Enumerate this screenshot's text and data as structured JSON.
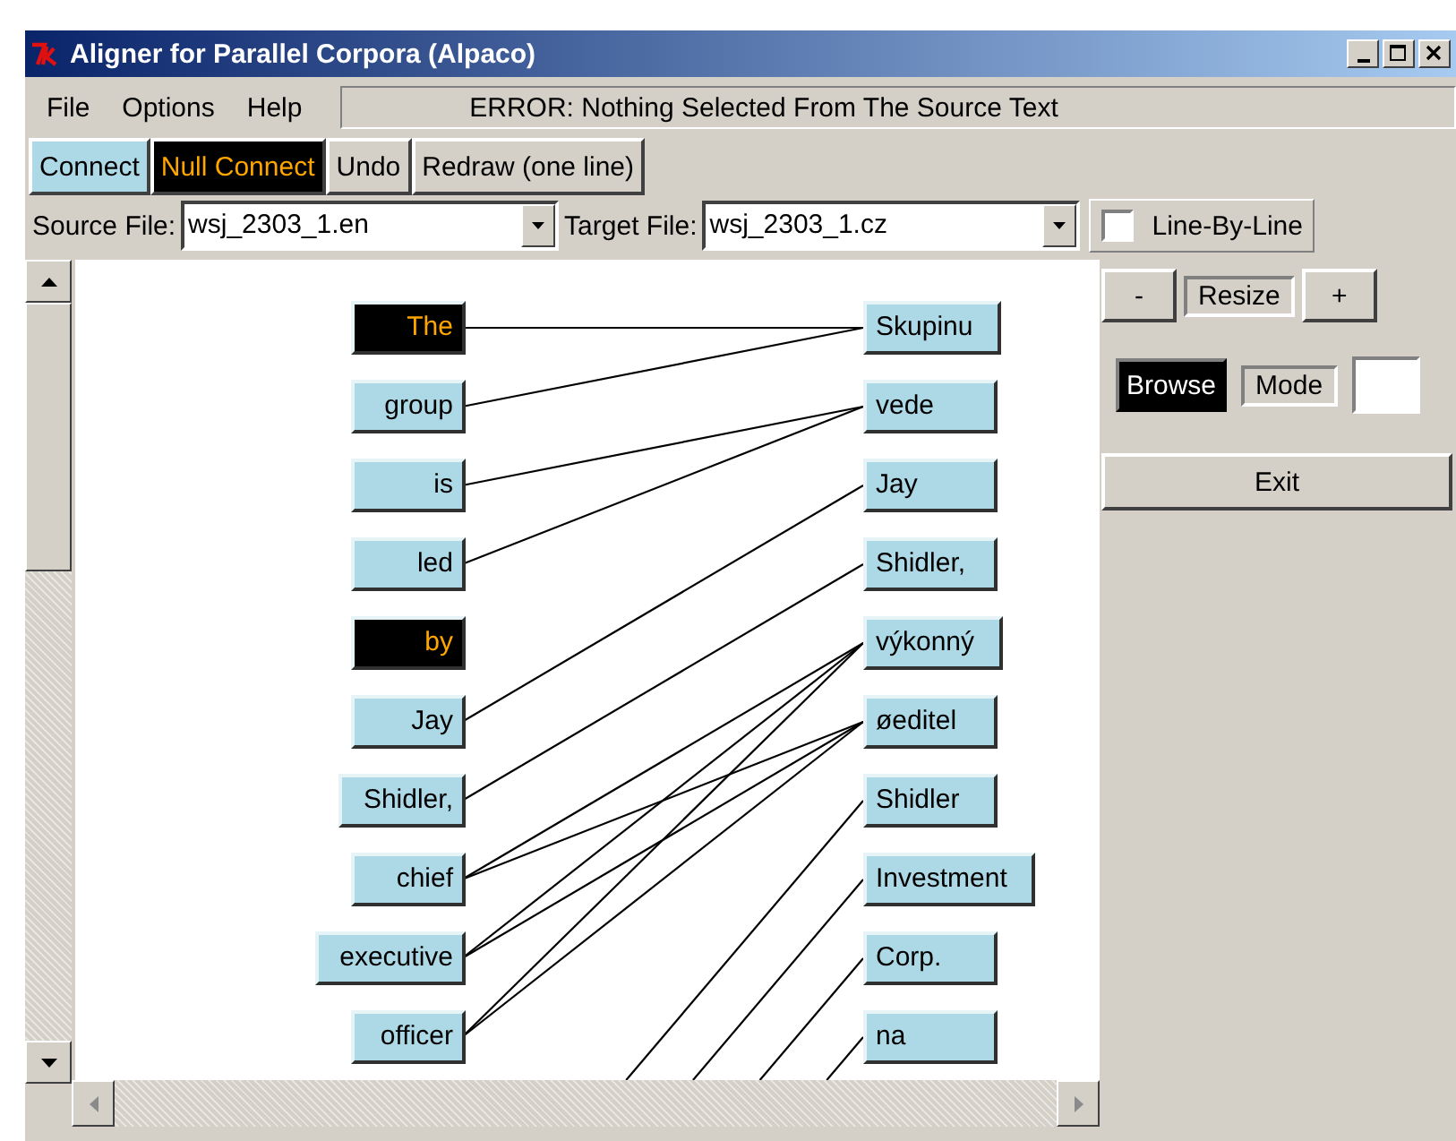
{
  "window": {
    "title": "Aligner for Parallel Corpora (Alpaco)"
  },
  "menu": [
    "File",
    "Options",
    "Help"
  ],
  "status_message": "ERROR: Nothing Selected From The Source Text",
  "toolbar": [
    {
      "label": "Connect",
      "kind": "light"
    },
    {
      "label": "Null Connect",
      "kind": "dark"
    },
    {
      "label": "Undo",
      "kind": "plain"
    },
    {
      "label": "Redraw (one line)",
      "kind": "plain"
    }
  ],
  "source_file": {
    "label": "Source File:",
    "value": "wsj_2303_1.en"
  },
  "target_file": {
    "label": "Target File:",
    "value": "wsj_2303_1.cz"
  },
  "line_by_line": {
    "label": "Line-By-Line",
    "checked": false
  },
  "source_words": [
    {
      "text": "The",
      "selected": true
    },
    {
      "text": "group",
      "selected": false
    },
    {
      "text": "is",
      "selected": false
    },
    {
      "text": "led",
      "selected": false
    },
    {
      "text": "by",
      "selected": true
    },
    {
      "text": "Jay",
      "selected": false
    },
    {
      "text": "Shidler,",
      "selected": false
    },
    {
      "text": "chief",
      "selected": false
    },
    {
      "text": "executive",
      "selected": false
    },
    {
      "text": "officer",
      "selected": false
    }
  ],
  "target_words": [
    {
      "text": "Skupinu",
      "selected": false
    },
    {
      "text": "vede",
      "selected": false
    },
    {
      "text": "Jay",
      "selected": false
    },
    {
      "text": "Shidler,",
      "selected": false
    },
    {
      "text": "výkonný",
      "selected": false
    },
    {
      "text": "øeditel",
      "selected": false
    },
    {
      "text": "Shidler",
      "selected": false
    },
    {
      "text": "Investment",
      "selected": false
    },
    {
      "text": "Corp.",
      "selected": false
    },
    {
      "text": "na",
      "selected": false
    }
  ],
  "resize": {
    "minus": "-",
    "label": "Resize",
    "plus": "+"
  },
  "mode": {
    "button": {
      "label": "Browse",
      "selected": true
    },
    "label": "Mode"
  },
  "exit": "Exit"
}
